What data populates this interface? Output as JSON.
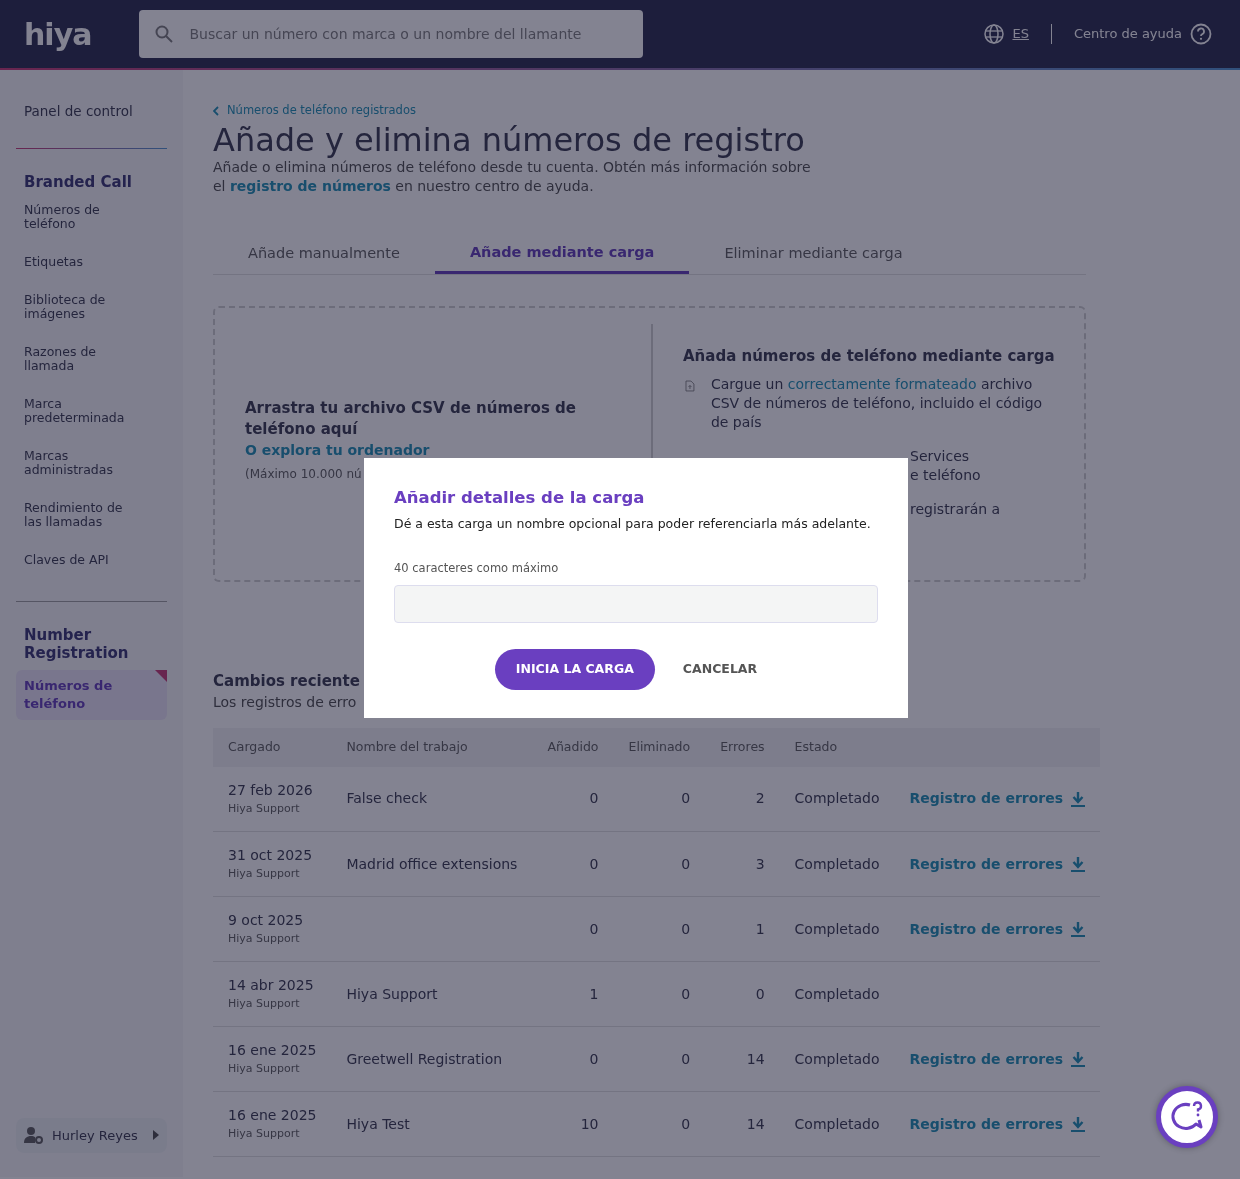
{
  "header": {
    "logo": "hiya",
    "search": {
      "placeholder": "Buscar un número con marca o un nombre del llamante"
    },
    "language": "ES",
    "help": "Centro de ayuda"
  },
  "sidebar": {
    "top_item": "Panel de control",
    "sections": [
      {
        "title": "Branded Call",
        "items": [
          {
            "label": "Números de teléfono",
            "selected": false
          },
          {
            "label": "Etiquetas",
            "selected": false
          },
          {
            "label": "Biblioteca de imágenes",
            "selected": false
          },
          {
            "label": "Razones de llamada",
            "selected": false
          },
          {
            "label": "Marca predeterminada",
            "selected": false
          },
          {
            "label": "Marcas administradas",
            "selected": false
          },
          {
            "label": "Rendimiento de las llamadas",
            "selected": false
          },
          {
            "label": "Claves de API",
            "selected": false
          }
        ]
      },
      {
        "title": "Number Registration",
        "items": [
          {
            "label": "Números de teléfono",
            "selected": true
          }
        ]
      }
    ],
    "user": "Hurley Reyes"
  },
  "breadcrumb": "Números de teléfono registrados",
  "title": "Añade y elimina números de registro",
  "description": {
    "before": "Añade o elimina números de teléfono desde tu cuenta. Obtén más información sobre el",
    "link": "registro de números",
    "after": "en nuestro centro de ayuda."
  },
  "tabs": [
    {
      "label": "Añade manualmente",
      "selected": false
    },
    {
      "label": "Añade mediante carga",
      "selected": true
    },
    {
      "label": "Eliminar mediante carga",
      "selected": false
    }
  ],
  "upload": {
    "drop_title": "Arrastra tu archivo CSV de números de teléfono aquí",
    "browse_link": "O explora tu ordenador",
    "limit_note": "(Máximo 10.000 nú",
    "info_title": "Añada números de teléfono mediante carga",
    "step": {
      "before": "Cargue un",
      "link": "correctamente formateado",
      "after": "archivo CSV de números de teléfono, incluido el código de país"
    },
    "partial_lines": [
      [
        "Services",
        "e teléfono"
      ],
      [
        "registrarán a"
      ]
    ]
  },
  "recent": {
    "title": "Cambios reciente",
    "subtitle": "Los registros de erro"
  },
  "table": {
    "columns": [
      "Cargado",
      "Nombre del trabajo",
      "Añadido",
      "Eliminado",
      "Errores",
      "Estado"
    ],
    "rows": [
      {
        "date": "27 feb 2026",
        "user": "Hiya Support",
        "job": "False check",
        "added": "0",
        "removed": "0",
        "errors": "2",
        "status": "Completado",
        "error_log": "Registro de errores"
      },
      {
        "date": "31 oct 2025",
        "user": "Hiya Support",
        "job": "Madrid office extensions",
        "added": "0",
        "removed": "0",
        "errors": "3",
        "status": "Completado",
        "error_log": "Registro de errores"
      },
      {
        "date": "9 oct 2025",
        "user": "Hiya Support",
        "added": "0",
        "removed": "0",
        "errors": "1",
        "status": "Completado",
        "error_log": "Registro de errores"
      },
      {
        "date": "14 abr 2025",
        "user": "Hiya Support",
        "job": "Hiya Support",
        "added": "1",
        "removed": "0",
        "errors": "0",
        "status": "Completado"
      },
      {
        "date": "16 ene 2025",
        "user": "Hiya Support",
        "job": "Greetwell Registration",
        "added": "0",
        "removed": "0",
        "errors": "14",
        "status": "Completado",
        "error_log": "Registro de errores"
      },
      {
        "date": "16 ene 2025",
        "user": "Hiya Support",
        "job": "Hiya Test",
        "added": "10",
        "removed": "0",
        "errors": "14",
        "status": "Completado",
        "error_log": "Registro de errores"
      }
    ]
  },
  "modal": {
    "title": "Añadir detalles de la carga",
    "description": "Dé a esta carga un nombre opcional para poder referenciarla más adelante.",
    "field_label": "40 caracteres como máximo",
    "primary_button": "INICIA LA CARGA",
    "cancel_button": "CANCELAR"
  }
}
